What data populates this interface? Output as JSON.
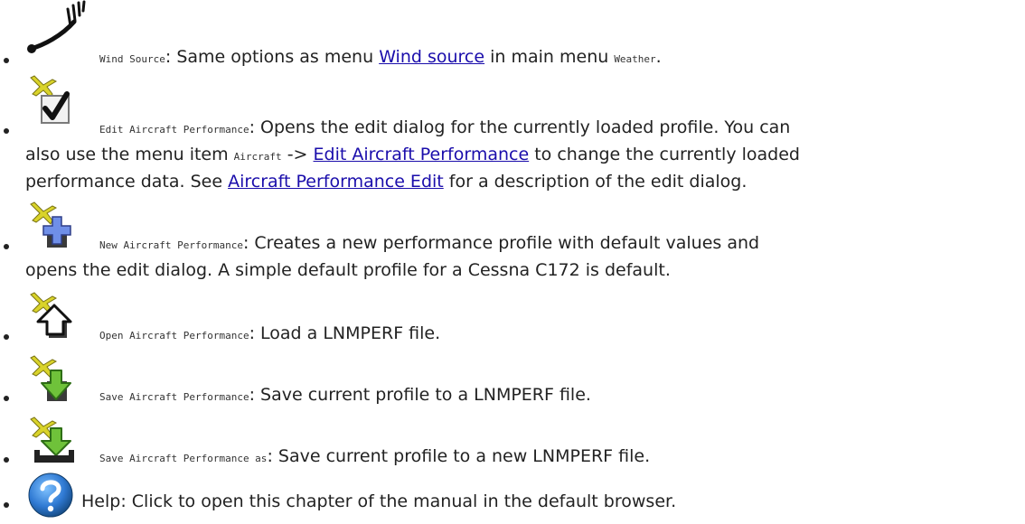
{
  "items": [
    {
      "icon": "wind-source-icon",
      "code": "Wind Source",
      "sep": ": ",
      "text1": "Same options as menu ",
      "link1": "Wind source",
      "text2": " in main menu ",
      "code2": "Weather",
      "text3": "."
    },
    {
      "icon": "edit-aircraft-performance-icon",
      "code": "Edit Aircraft Performance",
      "sep": ": ",
      "text1": "Opens the edit dialog for the currently loaded profile. You can",
      "text1b": "also use the menu item ",
      "code2": "Aircraft",
      "text2": " -> ",
      "link1": "Edit Aircraft Performance",
      "text3": " to change the currently loaded",
      "text4": "performance data. See ",
      "link2": "Aircraft Performance Edit",
      "text5": " for a description of the edit dialog."
    },
    {
      "icon": "new-aircraft-performance-icon",
      "code": "New Aircraft Performance",
      "sep": ": ",
      "text1": "Creates a new performance profile with default values and",
      "text2": "opens the edit dialog. A simple default profile for a Cessna C172 is default."
    },
    {
      "icon": "open-aircraft-performance-icon",
      "code": "Open Aircraft Performance",
      "sep": ": ",
      "text1": "Load a LNMPERF file."
    },
    {
      "icon": "save-aircraft-performance-icon",
      "code": "Save Aircraft Performance",
      "sep": ": ",
      "text1": "Save current profile to a LNMPERF file."
    },
    {
      "icon": "save-aircraft-performance-as-icon",
      "code": "Save Aircraft Performance as",
      "sep": ": ",
      "text1": "Save current profile to a new LNMPERF file."
    },
    {
      "icon": "help-icon",
      "label": "Help",
      "sep": ": ",
      "text1": "Click to open this chapter of the manual in the default browser."
    }
  ]
}
